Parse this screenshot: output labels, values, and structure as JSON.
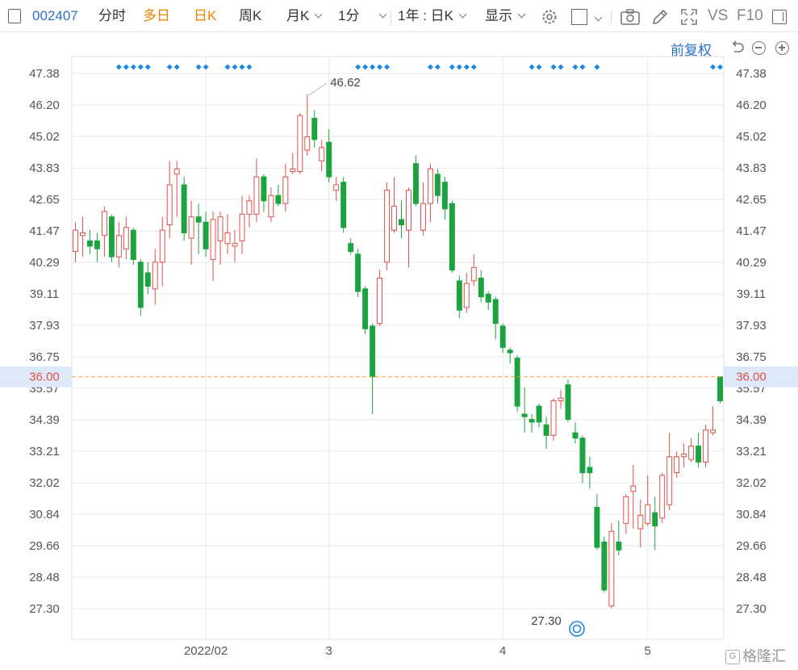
{
  "toolbar": {
    "code": "002407",
    "items": [
      "分时",
      "多日",
      "日K",
      "周K",
      "月K",
      "1分",
      "1年 : 日K",
      "显示"
    ],
    "vs": "VS",
    "f10": "F10"
  },
  "fuquan_label": "前复权",
  "watermark": "格隆汇",
  "colors": {
    "up": "#e0504a",
    "down": "#1aa33f",
    "grid": "#e8e8e8",
    "accent": "#2a72c8",
    "ref_line": "#f0a030",
    "ref_text": "#e0504a"
  },
  "chart_data": {
    "type": "candlestick",
    "ylim": [
      26.6,
      48.4
    ],
    "y_ticks": [
      "47.38",
      "46.20",
      "45.02",
      "43.83",
      "42.65",
      "41.47",
      "40.29",
      "39.11",
      "37.93",
      "36.75",
      "35.57",
      "34.39",
      "33.21",
      "32.02",
      "30.84",
      "29.66",
      "28.48",
      "27.30"
    ],
    "x_ticks": [
      {
        "label": "2022/02",
        "index": 18
      },
      {
        "label": "3",
        "index": 35
      },
      {
        "label": "4",
        "index": 59
      },
      {
        "label": "5",
        "index": 79
      }
    ],
    "reference_line": {
      "value": 36.0,
      "label": "36.00"
    },
    "annotations": [
      {
        "label": "46.62",
        "value": 46.62,
        "index": 32
      },
      {
        "label": "27.30",
        "value": 27.3,
        "index": 75
      }
    ],
    "event_markers": [
      6,
      7,
      8,
      9,
      10,
      13,
      14,
      17,
      18,
      21,
      22,
      23,
      24,
      39,
      40,
      41,
      42,
      43,
      49,
      50,
      52,
      53,
      54,
      55,
      63,
      64,
      66,
      67,
      69,
      70,
      72,
      88,
      89
    ],
    "candles": [
      {
        "o": 40.7,
        "c": 41.5,
        "h": 41.8,
        "l": 40.3
      },
      {
        "o": 41.3,
        "c": 41.4,
        "h": 42.0,
        "l": 40.5
      },
      {
        "o": 41.1,
        "c": 40.9,
        "h": 41.5,
        "l": 40.6
      },
      {
        "o": 41.1,
        "c": 40.8,
        "h": 41.4,
        "l": 40.3
      },
      {
        "o": 41.3,
        "c": 42.2,
        "h": 42.4,
        "l": 40.5
      },
      {
        "o": 42.0,
        "c": 40.5,
        "h": 42.1,
        "l": 40.3
      },
      {
        "o": 40.5,
        "c": 41.3,
        "h": 41.8,
        "l": 40.1
      },
      {
        "o": 40.8,
        "c": 41.6,
        "h": 42.0,
        "l": 40.4
      },
      {
        "o": 41.5,
        "c": 40.4,
        "h": 41.6,
        "l": 40.2
      },
      {
        "o": 40.3,
        "c": 38.6,
        "h": 40.4,
        "l": 38.3
      },
      {
        "o": 39.9,
        "c": 39.4,
        "h": 40.3,
        "l": 39.1
      },
      {
        "o": 39.3,
        "c": 40.3,
        "h": 40.8,
        "l": 38.7
      },
      {
        "o": 40.3,
        "c": 41.5,
        "h": 42.0,
        "l": 39.4
      },
      {
        "o": 41.7,
        "c": 43.2,
        "h": 44.1,
        "l": 41.2
      },
      {
        "o": 43.6,
        "c": 43.8,
        "h": 44.1,
        "l": 42.0
      },
      {
        "o": 43.2,
        "c": 41.4,
        "h": 43.5,
        "l": 41.1
      },
      {
        "o": 41.2,
        "c": 42.0,
        "h": 42.6,
        "l": 40.2
      },
      {
        "o": 42.0,
        "c": 41.8,
        "h": 42.5,
        "l": 40.6
      },
      {
        "o": 41.8,
        "c": 40.8,
        "h": 42.2,
        "l": 40.5
      },
      {
        "o": 40.4,
        "c": 41.9,
        "h": 42.2,
        "l": 39.6
      },
      {
        "o": 41.1,
        "c": 42.0,
        "h": 42.2,
        "l": 40.2
      },
      {
        "o": 41.0,
        "c": 41.4,
        "h": 42.1,
        "l": 40.6
      },
      {
        "o": 40.9,
        "c": 41.0,
        "h": 41.5,
        "l": 40.3
      },
      {
        "o": 41.1,
        "c": 42.1,
        "h": 42.8,
        "l": 40.6
      },
      {
        "o": 42.1,
        "c": 42.6,
        "h": 42.8,
        "l": 41.6
      },
      {
        "o": 42.1,
        "c": 43.5,
        "h": 44.2,
        "l": 41.8
      },
      {
        "o": 43.5,
        "c": 42.6,
        "h": 43.6,
        "l": 42.2
      },
      {
        "o": 42.0,
        "c": 42.8,
        "h": 43.1,
        "l": 41.8
      },
      {
        "o": 42.8,
        "c": 42.5,
        "h": 43.2,
        "l": 42.4
      },
      {
        "o": 42.5,
        "c": 43.5,
        "h": 44.0,
        "l": 42.2
      },
      {
        "o": 43.7,
        "c": 43.8,
        "h": 44.4,
        "l": 43.6
      },
      {
        "o": 43.7,
        "c": 45.8,
        "h": 45.9,
        "l": 43.6
      },
      {
        "o": 44.5,
        "c": 45.0,
        "h": 46.6,
        "l": 44.3
      },
      {
        "o": 45.7,
        "c": 44.9,
        "h": 46.0,
        "l": 44.6
      },
      {
        "o": 44.1,
        "c": 44.6,
        "h": 44.9,
        "l": 43.7
      },
      {
        "o": 44.8,
        "c": 43.5,
        "h": 45.3,
        "l": 43.3
      },
      {
        "o": 43.0,
        "c": 43.2,
        "h": 43.5,
        "l": 42.6
      },
      {
        "o": 43.3,
        "c": 41.6,
        "h": 43.5,
        "l": 41.4
      },
      {
        "o": 41.0,
        "c": 40.7,
        "h": 41.2,
        "l": 40.6
      },
      {
        "o": 40.6,
        "c": 39.2,
        "h": 40.8,
        "l": 39.0
      },
      {
        "o": 39.3,
        "c": 37.8,
        "h": 39.4,
        "l": 37.6
      },
      {
        "o": 37.9,
        "c": 36.0,
        "h": 38.0,
        "l": 34.6
      },
      {
        "o": 38.0,
        "c": 39.7,
        "h": 40.0,
        "l": 37.9
      },
      {
        "o": 40.3,
        "c": 43.0,
        "h": 43.3,
        "l": 40.0
      },
      {
        "o": 41.5,
        "c": 42.4,
        "h": 43.5,
        "l": 41.4
      },
      {
        "o": 41.9,
        "c": 41.7,
        "h": 42.6,
        "l": 41.2
      },
      {
        "o": 41.5,
        "c": 43.0,
        "h": 43.1,
        "l": 40.1
      },
      {
        "o": 44.0,
        "c": 42.5,
        "h": 44.3,
        "l": 42.4
      },
      {
        "o": 41.5,
        "c": 42.5,
        "h": 43.3,
        "l": 41.3
      },
      {
        "o": 42.5,
        "c": 43.8,
        "h": 44.0,
        "l": 41.8
      },
      {
        "o": 43.6,
        "c": 42.8,
        "h": 43.8,
        "l": 42.5
      },
      {
        "o": 43.3,
        "c": 42.3,
        "h": 43.5,
        "l": 41.9
      },
      {
        "o": 42.5,
        "c": 40.0,
        "h": 42.6,
        "l": 39.9
      },
      {
        "o": 39.6,
        "c": 38.5,
        "h": 39.8,
        "l": 38.2
      },
      {
        "o": 38.6,
        "c": 39.5,
        "h": 39.9,
        "l": 38.4
      },
      {
        "o": 39.6,
        "c": 40.1,
        "h": 40.6,
        "l": 39.4
      },
      {
        "o": 39.7,
        "c": 39.0,
        "h": 40.0,
        "l": 38.8
      },
      {
        "o": 39.1,
        "c": 38.8,
        "h": 39.2,
        "l": 38.5
      },
      {
        "o": 38.9,
        "c": 38.0,
        "h": 39.0,
        "l": 37.4
      },
      {
        "o": 37.9,
        "c": 37.1,
        "h": 38.0,
        "l": 36.9
      },
      {
        "o": 37.0,
        "c": 36.9,
        "h": 37.1,
        "l": 36.5
      },
      {
        "o": 36.7,
        "c": 34.9,
        "h": 36.8,
        "l": 34.7
      },
      {
        "o": 34.6,
        "c": 34.5,
        "h": 35.6,
        "l": 33.9
      },
      {
        "o": 34.4,
        "c": 34.3,
        "h": 34.6,
        "l": 33.9
      },
      {
        "o": 34.9,
        "c": 34.3,
        "h": 35.0,
        "l": 34.1
      },
      {
        "o": 34.2,
        "c": 33.8,
        "h": 34.5,
        "l": 33.3
      },
      {
        "o": 33.8,
        "c": 35.1,
        "h": 35.2,
        "l": 33.6
      },
      {
        "o": 35.1,
        "c": 35.2,
        "h": 35.5,
        "l": 34.8
      },
      {
        "o": 35.7,
        "c": 34.4,
        "h": 35.9,
        "l": 34.3
      },
      {
        "o": 33.9,
        "c": 33.7,
        "h": 34.3,
        "l": 33.5
      },
      {
        "o": 33.7,
        "c": 32.4,
        "h": 33.8,
        "l": 32.0
      },
      {
        "o": 32.6,
        "c": 32.4,
        "h": 33.0,
        "l": 31.8
      },
      {
        "o": 31.1,
        "c": 29.6,
        "h": 31.6,
        "l": 29.5
      },
      {
        "o": 29.8,
        "c": 28.0,
        "h": 30.0,
        "l": 27.9
      },
      {
        "o": 27.4,
        "c": 30.2,
        "h": 30.5,
        "l": 27.3
      },
      {
        "o": 29.8,
        "c": 29.5,
        "h": 30.6,
        "l": 29.3
      },
      {
        "o": 30.5,
        "c": 31.5,
        "h": 31.6,
        "l": 30.1
      },
      {
        "o": 31.7,
        "c": 31.9,
        "h": 32.7,
        "l": 30.3
      },
      {
        "o": 30.3,
        "c": 30.8,
        "h": 31.4,
        "l": 29.6
      },
      {
        "o": 30.5,
        "c": 31.2,
        "h": 32.3,
        "l": 30.4
      },
      {
        "o": 30.9,
        "c": 30.4,
        "h": 31.5,
        "l": 29.5
      },
      {
        "o": 30.7,
        "c": 32.3,
        "h": 32.4,
        "l": 30.5
      },
      {
        "o": 31.2,
        "c": 33.0,
        "h": 33.9,
        "l": 31.0
      },
      {
        "o": 32.4,
        "c": 33.0,
        "h": 33.2,
        "l": 32.2
      },
      {
        "o": 33.0,
        "c": 33.1,
        "h": 33.5,
        "l": 32.6
      },
      {
        "o": 32.9,
        "c": 33.4,
        "h": 33.7,
        "l": 32.8
      },
      {
        "o": 33.4,
        "c": 32.8,
        "h": 33.9,
        "l": 32.6
      },
      {
        "o": 32.8,
        "c": 34.0,
        "h": 34.2,
        "l": 32.6
      },
      {
        "o": 33.9,
        "c": 34.0,
        "h": 34.9,
        "l": 33.8
      },
      {
        "o": 36.0,
        "c": 35.1,
        "h": 36.0,
        "l": 35.0
      }
    ]
  }
}
